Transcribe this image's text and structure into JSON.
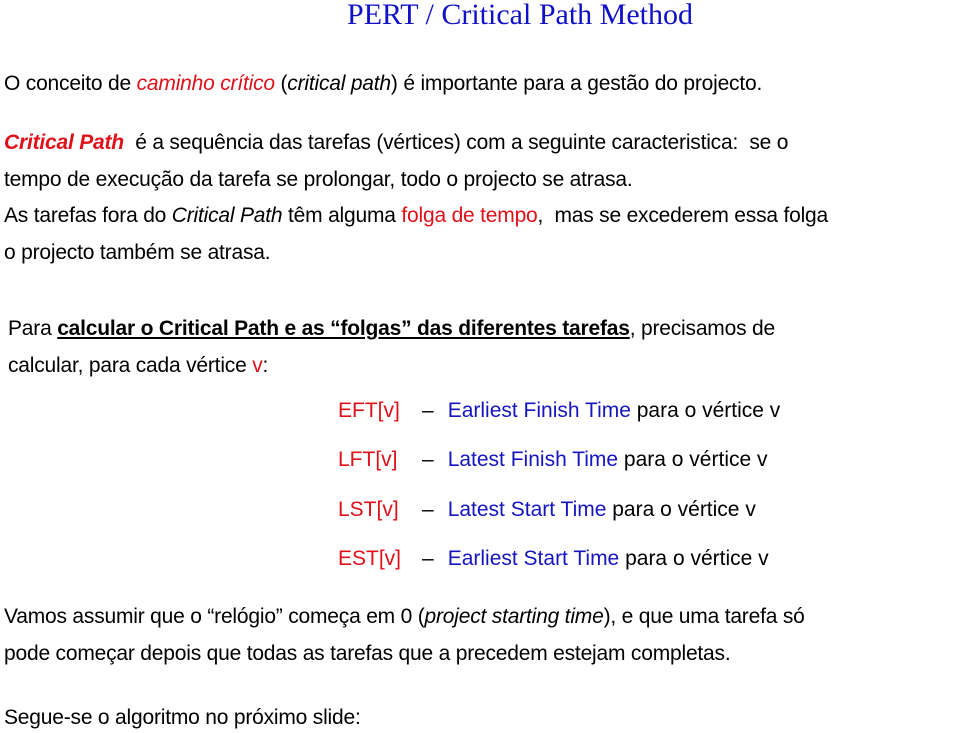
{
  "title": "PERT / Critical Path Method",
  "colors": {
    "title": "#1010c8",
    "accent_red": "#e0101a",
    "accent_blue": "#1515c0",
    "text": "#000000"
  },
  "para1": {
    "p1": "O conceito de ",
    "red_italic": "caminho crítico",
    "p2": " (",
    "italic": "critical path",
    "p3": ") é importante para a gestão do projecto."
  },
  "para2": {
    "bold_red": "Critical Path",
    "line1_rest": "  é a sequência das tarefas (vértices) com a seguinte caracteristica:  se o",
    "line2": "tempo de execução da tarefa se prolongar, todo o projecto se atrasa.",
    "line3_p1": "As tarefas fora do ",
    "line3_italic": "Critical Path",
    "line3_p2": " têm alguma ",
    "line3_red": "folga de tempo",
    "line3_p3": ",  mas se excederem essa folga",
    "line4": "o projecto também se atrasa."
  },
  "para3": {
    "p1": "Para ",
    "bold_underline": "calcular o Critical Path e as “folgas” das diferentes tarefas",
    "p2": ", precisamos de",
    "line2_p1": "calcular, para cada vértice ",
    "line2_red": "v",
    "line2_p2": ":"
  },
  "definitions": [
    {
      "abbr": "EFT[v]",
      "dash": "–",
      "term": "Earliest Finish Time",
      "rest": " para o vértice v"
    },
    {
      "abbr": "LFT[v]",
      "dash": "–",
      "term": "Latest Finish Time",
      "rest": " para o vértice v"
    },
    {
      "abbr": "LST[v]",
      "dash": "–",
      "term": "Latest Start Time",
      "rest": " para o vértice v"
    },
    {
      "abbr": "EST[v]",
      "dash": "–",
      "term": "Earliest Start Time",
      "rest": " para o vértice v"
    }
  ],
  "para4": {
    "p1": "Vamos assumir que o “relógio” começa em 0 (",
    "italic": "project starting time",
    "p2": "), e que uma tarefa só",
    "line2": "pode começar depois que todas as tarefas que a precedem estejam completas."
  },
  "footer": "Segue-se o algoritmo no próximo slide:"
}
